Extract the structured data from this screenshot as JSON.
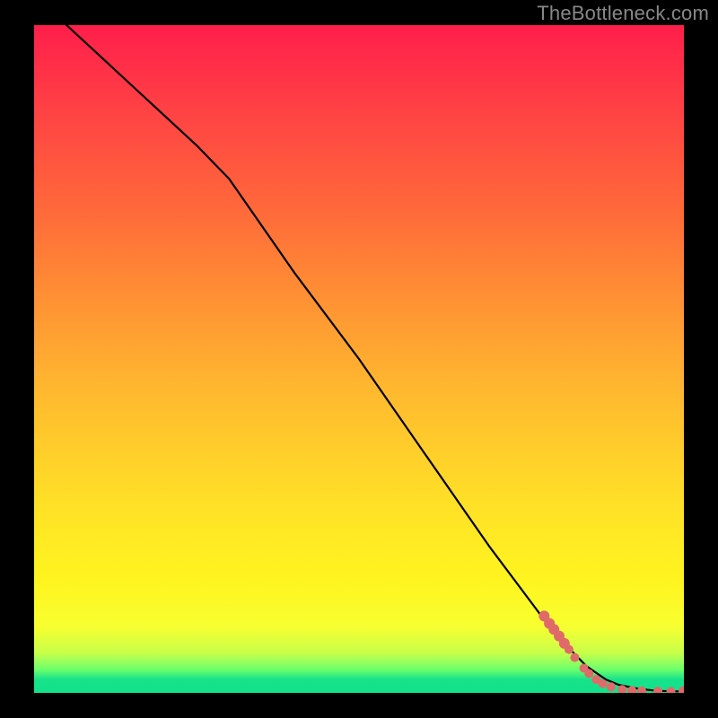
{
  "watermark": "TheBottleneck.com",
  "chart_data": {
    "type": "line",
    "title": "",
    "xlabel": "",
    "ylabel": "",
    "xlim": [
      0,
      100
    ],
    "ylim": [
      0,
      100
    ],
    "grid": false,
    "legend": false,
    "series": [
      {
        "name": "curve",
        "color": "#000000",
        "x": [
          5,
          15,
          25,
          30,
          40,
          50,
          60,
          70,
          80,
          85,
          88,
          90,
          93,
          96,
          100
        ],
        "y": [
          100,
          91,
          82,
          77,
          63,
          50,
          36,
          22,
          9,
          4,
          2,
          1.2,
          0.6,
          0.3,
          0.2
        ]
      }
    ],
    "markers": [
      {
        "name": "marker-0",
        "x": 78.5,
        "y": 11.5,
        "r": 6
      },
      {
        "name": "marker-1",
        "x": 79.3,
        "y": 10.4,
        "r": 6
      },
      {
        "name": "marker-2",
        "x": 80.0,
        "y": 9.5,
        "r": 6
      },
      {
        "name": "marker-3",
        "x": 80.8,
        "y": 8.5,
        "r": 6
      },
      {
        "name": "marker-4",
        "x": 81.6,
        "y": 7.4,
        "r": 6
      },
      {
        "name": "marker-5",
        "x": 82.3,
        "y": 6.5,
        "r": 5
      },
      {
        "name": "marker-6",
        "x": 83.2,
        "y": 5.3,
        "r": 5
      },
      {
        "name": "marker-7",
        "x": 84.6,
        "y": 3.7,
        "r": 5
      },
      {
        "name": "marker-8",
        "x": 85.4,
        "y": 2.9,
        "r": 5
      },
      {
        "name": "marker-9",
        "x": 86.5,
        "y": 2.0,
        "r": 5
      },
      {
        "name": "marker-10",
        "x": 87.5,
        "y": 1.4,
        "r": 5
      },
      {
        "name": "marker-11",
        "x": 88.8,
        "y": 0.9,
        "r": 5
      },
      {
        "name": "marker-12",
        "x": 90.5,
        "y": 0.5,
        "r": 5
      },
      {
        "name": "marker-13",
        "x": 92.0,
        "y": 0.35,
        "r": 5
      },
      {
        "name": "marker-14",
        "x": 93.5,
        "y": 0.3,
        "r": 5
      },
      {
        "name": "marker-15",
        "x": 96.0,
        "y": 0.25,
        "r": 5
      },
      {
        "name": "marker-16",
        "x": 98.0,
        "y": 0.22,
        "r": 5
      },
      {
        "name": "marker-17",
        "x": 100.0,
        "y": 0.2,
        "r": 6
      }
    ],
    "marker_color": "#e06a6a"
  }
}
